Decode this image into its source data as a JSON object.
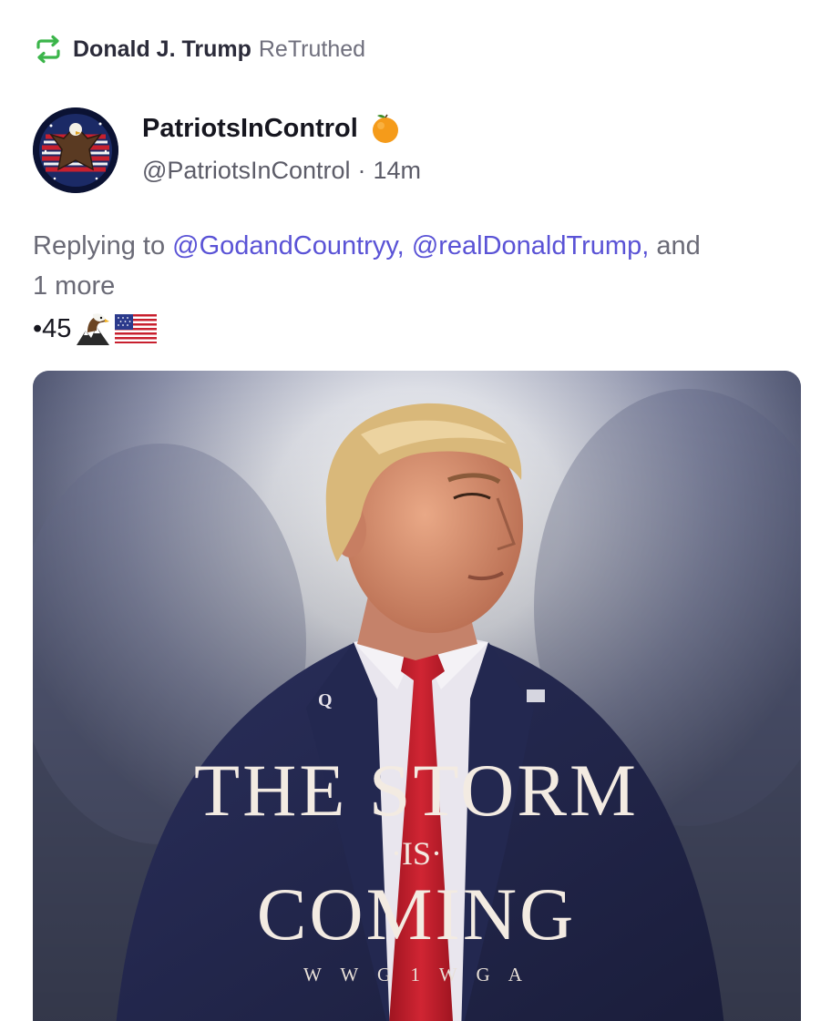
{
  "retruth": {
    "user": "Donald J. Trump",
    "label": "ReTruthed",
    "icon": "retruth-icon",
    "color": "#3bb54a"
  },
  "post": {
    "author": {
      "name": "PatriotsInControl",
      "handle": "@PatriotsInControl",
      "separator": "·",
      "time": "14m",
      "badge_icon": "orange-emoji-icon"
    },
    "reply": {
      "prefix": "Replying to",
      "mention1": "@GodandCountryy,",
      "mention2": "@realDonaldTrump,",
      "suffix": "and",
      "more": "1 more"
    },
    "body": {
      "text": "•45",
      "emojis": [
        "eagle-emoji-icon",
        "us-flag-emoji-icon"
      ]
    },
    "media": {
      "line1": "THE STORM",
      "line2": "·IS·",
      "line3": "COMING",
      "line4": "W W G 1 W G A",
      "pin_letter": "Q"
    }
  },
  "colors": {
    "mention": "#5a53d6",
    "muted": "#6a6a76",
    "retruth_green": "#3bb54a"
  }
}
